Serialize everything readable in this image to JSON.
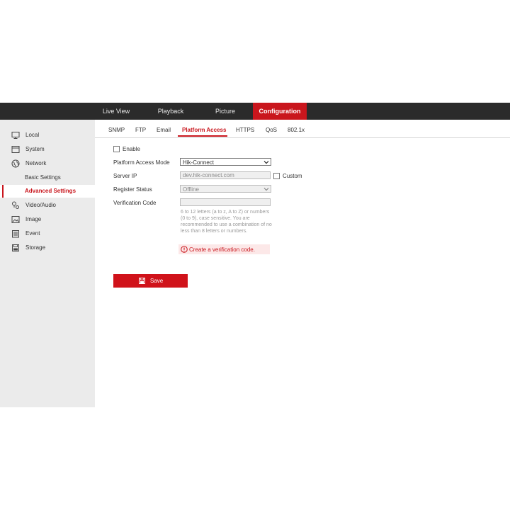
{
  "top_nav": {
    "items": [
      {
        "label": "Live View"
      },
      {
        "label": "Playback"
      },
      {
        "label": "Picture"
      },
      {
        "label": "Configuration"
      }
    ],
    "active": "Configuration",
    "active_color": "#c9161d"
  },
  "sidebar": {
    "items": [
      {
        "label": "Local",
        "icon": "monitor-icon"
      },
      {
        "label": "System",
        "icon": "system-icon"
      },
      {
        "label": "Network",
        "icon": "globe-icon"
      },
      {
        "label": "Basic Settings"
      },
      {
        "label": "Advanced Settings"
      },
      {
        "label": "Video/Audio",
        "icon": "video-audio-icon"
      },
      {
        "label": "Image",
        "icon": "image-icon"
      },
      {
        "label": "Event",
        "icon": "event-icon"
      },
      {
        "label": "Storage",
        "icon": "storage-icon"
      }
    ],
    "active": "Advanced Settings"
  },
  "tabs": {
    "items": [
      {
        "label": "SNMP"
      },
      {
        "label": "FTP"
      },
      {
        "label": "Email"
      },
      {
        "label": "Platform Access"
      },
      {
        "label": "HTTPS"
      },
      {
        "label": "QoS"
      },
      {
        "label": "802.1x"
      }
    ],
    "active": "Platform Access"
  },
  "form": {
    "enable_label": "Enable",
    "enable_checked": false,
    "platform_access_mode_label": "Platform Access Mode",
    "platform_access_mode_value": "Hik-Connect",
    "server_ip_label": "Server IP",
    "server_ip_value": "dev.hik-connect.com",
    "custom_label": "Custom",
    "custom_checked": false,
    "register_status_label": "Register Status",
    "register_status_value": "Offline",
    "verification_code_label": "Verification Code",
    "verification_code_value": "",
    "hint": "6 to 12 letters (a to z, A to Z) or numbers (0 to 9), case sensitive. You are recommended to use a combination of no less than 8 letters or numbers.",
    "error_text": "Create a verification code.",
    "save_label": "Save"
  }
}
